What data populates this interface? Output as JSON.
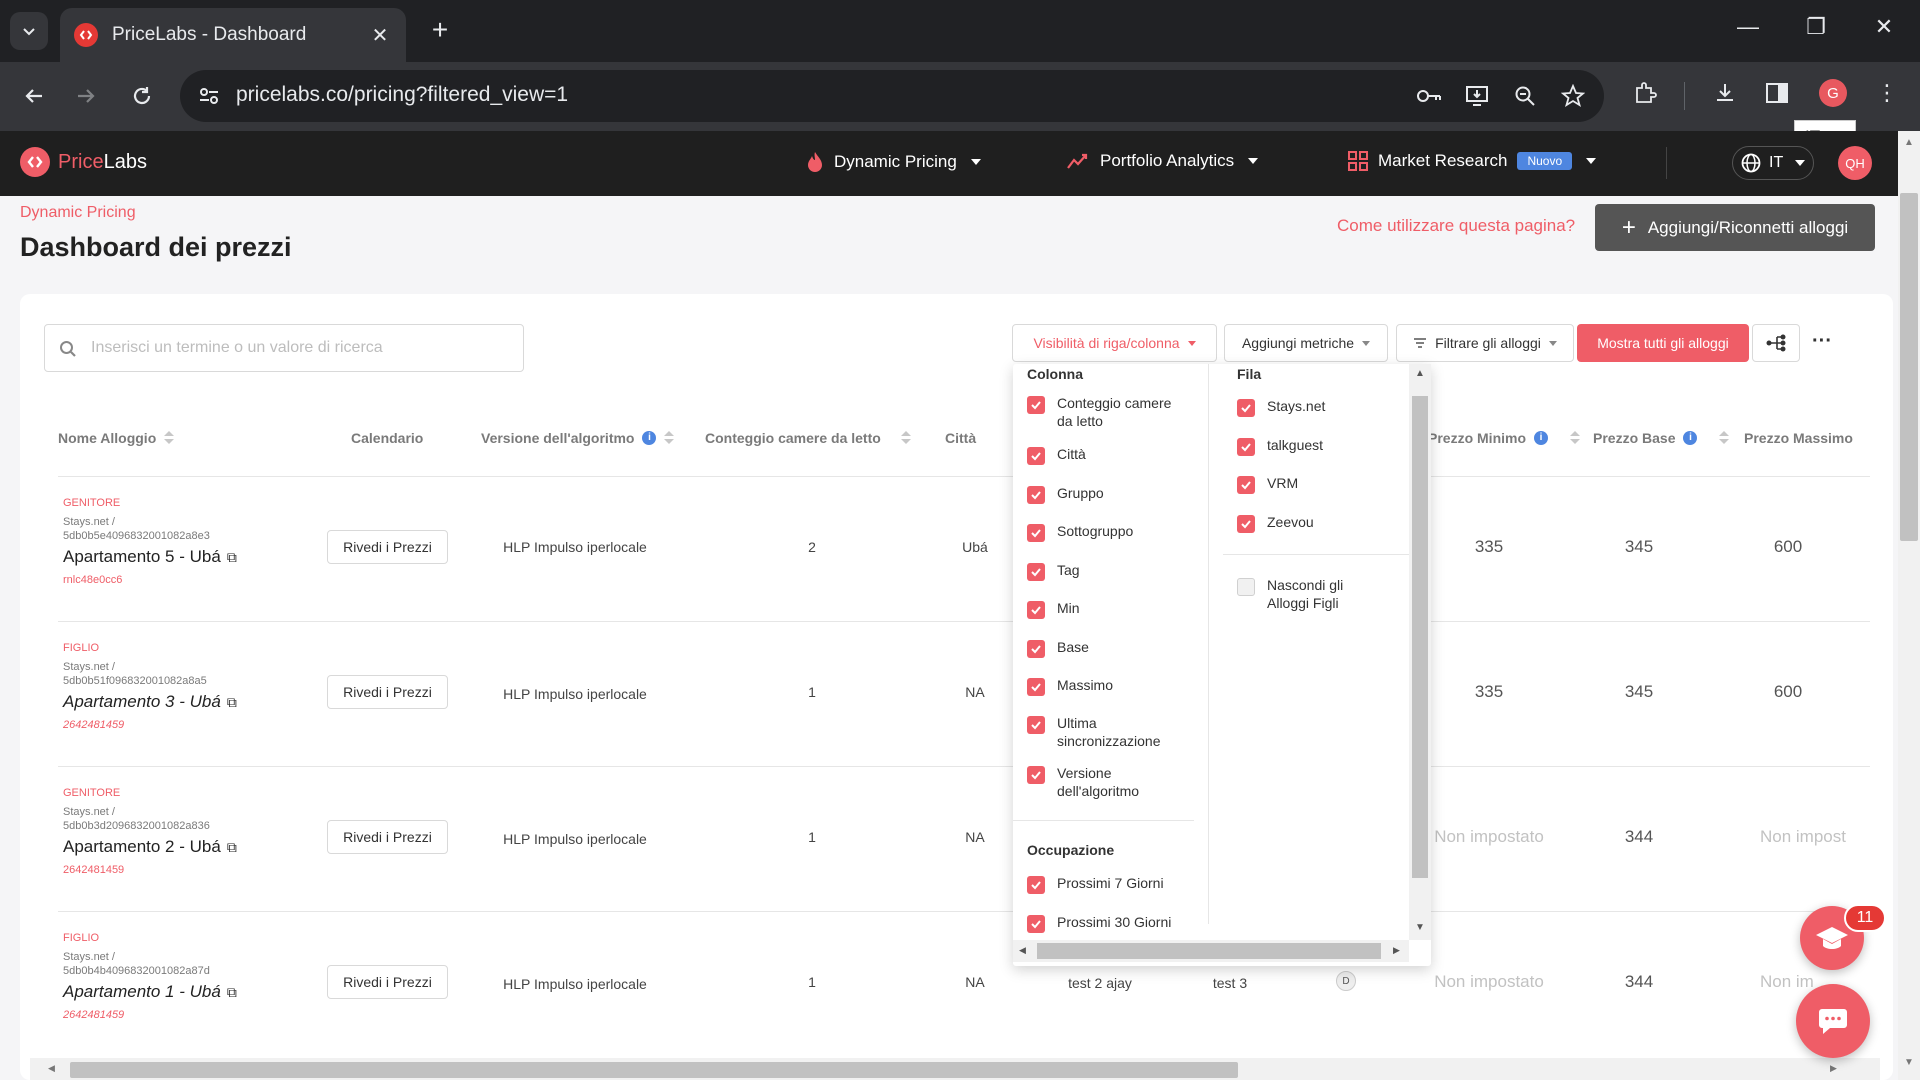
{
  "browser": {
    "tab_title": "PriceLabs - Dashboard",
    "url": "pricelabs.co/pricing?filtered_view=1",
    "profile_initial": "G",
    "translate_label": "IT"
  },
  "app_nav": {
    "logo_prefix": "Price",
    "logo_suffix": "Labs",
    "items": [
      {
        "label": "Dynamic Pricing"
      },
      {
        "label": "Portfolio Analytics"
      },
      {
        "label": "Market Research"
      }
    ],
    "new_badge": "Nuovo",
    "language": "IT",
    "user_initials": "QH"
  },
  "page": {
    "breadcrumb": "Dynamic Pricing",
    "title": "Dashboard dei prezzi",
    "help_link": "Come utilizzare questa pagina?",
    "add_button": "Aggiungi/Riconnetti alloggi"
  },
  "toolbar": {
    "search_placeholder": "Inserisci un termine o un valore di ricerca",
    "visibility_button": "Visibilità di riga/colonna",
    "metrics_button": "Aggiungi metriche",
    "filter_button": "Filtrare gli alloggi",
    "show_all_button": "Mostra tutti gli alloggi"
  },
  "table": {
    "headers": {
      "name": "Nome Alloggio",
      "calendar": "Calendario",
      "algo": "Versione dell'algoritmo",
      "bedrooms": "Conteggio camere da letto",
      "city": "Città",
      "min": "Prezzo Minimo",
      "base": "Prezzo Base",
      "max": "Prezzo Massimo"
    },
    "review_label": "Rivedi i Prezzi",
    "rows": [
      {
        "role": "GENITORE",
        "source": "Stays.net /",
        "source_id": "5db0b5e4096832001082a8e3",
        "name": "Apartamento 5 - Ubá",
        "pid": "rnlc48e0cc6",
        "algo": "HLP Impulso iperlocale",
        "bedrooms": "2",
        "city": "Ubá",
        "min": "335",
        "base": "345",
        "max": "600"
      },
      {
        "role": "FIGLIO",
        "source": "Stays.net /",
        "source_id": "5db0b51f096832001082a8a5",
        "name": "Apartamento 3 - Ubá",
        "pid": "2642481459",
        "algo": "HLP Impulso iperlocale",
        "bedrooms": "1",
        "city": "NA",
        "min": "335",
        "base": "345",
        "max": "600"
      },
      {
        "role": "GENITORE",
        "source": "Stays.net /",
        "source_id": "5db0b3d2096832001082a836",
        "name": "Apartamento 2 - Ubá",
        "pid": "2642481459",
        "algo": "HLP Impulso iperlocale",
        "bedrooms": "1",
        "city": "NA",
        "min": "Non impostato",
        "base": "344",
        "max": "Non impost"
      },
      {
        "role": "FIGLIO",
        "source": "Stays.net /",
        "source_id": "5db0b4b4096832001082a87d",
        "name": "Apartamento 1 - Ubá",
        "pid": "2642481459",
        "algo": "HLP Impulso iperlocale",
        "bedrooms": "1",
        "city": "NA",
        "group": "test 2 ajay",
        "subgroup": "test 3",
        "tag": "D",
        "min": "Non impostato",
        "base": "344",
        "max": "Non im"
      }
    ]
  },
  "visibility_dropdown": {
    "column_heading": "Colonna",
    "columns": [
      "Conteggio camere da letto",
      "Città",
      "Gruppo",
      "Sottogruppo",
      "Tag",
      "Min",
      "Base",
      "Massimo",
      "Ultima sincronizzazione",
      "Versione dell'algoritmo"
    ],
    "occupancy_heading": "Occupazione",
    "occupancy": [
      "Prossimi 7 Giorni",
      "Prossimi 30 Giorni"
    ],
    "row_heading": "Fila",
    "rows": [
      "Stays.net",
      "talkguest",
      "VRM",
      "Zeevou"
    ],
    "hide_children": "Nascondi gli Alloggi Figli"
  },
  "widgets": {
    "notification_count": "11"
  },
  "colors": {
    "accent": "#ef5d67",
    "nav_bg": "#1f1f1f",
    "info_blue": "#4e86e0",
    "badge_blue": "#4e86e0"
  }
}
